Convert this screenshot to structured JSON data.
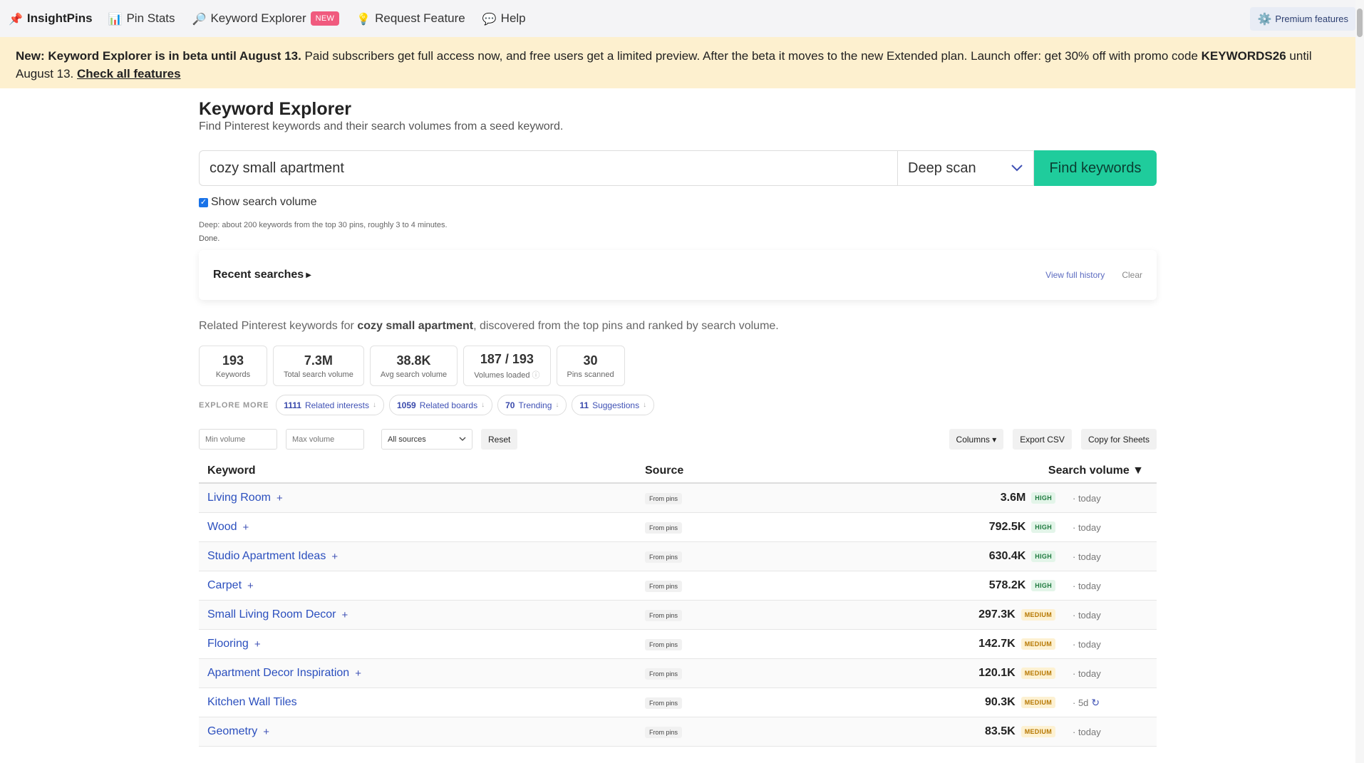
{
  "nav": {
    "brand": "InsightPins",
    "items": [
      {
        "label": "Pin Stats",
        "icon": "📊"
      },
      {
        "label": "Keyword Explorer",
        "icon": "🔎",
        "badge": "NEW"
      },
      {
        "label": "Request Feature",
        "icon": "💡"
      },
      {
        "label": "Help",
        "icon": "💬"
      }
    ],
    "brand_icon": "📌",
    "premium_label": "Premium features",
    "premium_icon": "⚙️"
  },
  "banner": {
    "lead": "New: Keyword Explorer is in beta until August 13.",
    "body": " Paid subscribers get full access now, and free users get a limited preview. After the beta it moves to the new Extended plan. Launch offer: get 30% off with promo code ",
    "promo": "KEYWORDS26",
    "tail": " until August 13. ",
    "link": "Check all features"
  },
  "page": {
    "title": "Keyword Explorer",
    "subtitle": "Find Pinterest keywords and their search volumes from a seed keyword."
  },
  "search": {
    "value": "cozy small apartment",
    "scan_mode": "Deep scan",
    "button": "Find keywords",
    "show_volume_label": "Show search volume",
    "show_volume_checked": true,
    "hint": "Deep: about 200 keywords from the top 30 pins, roughly 3 to 4 minutes.",
    "status": "Done."
  },
  "recent": {
    "title": "Recent searches",
    "view_history": "View full history",
    "clear": "Clear"
  },
  "results_intro": {
    "prefix": "Related Pinterest keywords for ",
    "seed": "cozy small apartment",
    "suffix": ", discovered from the top pins and ranked by search volume."
  },
  "stats": [
    {
      "value": "193",
      "label": "Keywords"
    },
    {
      "value": "7.3M",
      "label": "Total search volume"
    },
    {
      "value": "38.8K",
      "label": "Avg search volume"
    },
    {
      "value": "187 / 193",
      "label": "Volumes loaded"
    },
    {
      "value": "30",
      "label": "Pins scanned"
    }
  ],
  "explore": {
    "label": "EXPLORE MORE",
    "chips": [
      {
        "count": "1111",
        "label": "Related interests"
      },
      {
        "count": "1059",
        "label": "Related boards"
      },
      {
        "count": "70",
        "label": "Trending"
      },
      {
        "count": "11",
        "label": "Suggestions"
      }
    ]
  },
  "filters": {
    "min_placeholder": "Min volume",
    "max_placeholder": "Max volume",
    "source_selected": "All sources",
    "reset": "Reset",
    "columns": "Columns ▾",
    "export": "Export CSV",
    "copy": "Copy for Sheets"
  },
  "table": {
    "headers": {
      "keyword": "Keyword",
      "source": "Source",
      "volume": "Search volume ▼"
    },
    "rows": [
      {
        "keyword": "Living Room",
        "plus": "+",
        "source": "From pins",
        "volume": "3.6M",
        "level": "HIGH",
        "age": "· today",
        "refresh": ""
      },
      {
        "keyword": "Wood",
        "plus": "+",
        "source": "From pins",
        "volume": "792.5K",
        "level": "HIGH",
        "age": "· today",
        "refresh": ""
      },
      {
        "keyword": "Studio Apartment Ideas",
        "plus": "+",
        "source": "From pins",
        "volume": "630.4K",
        "level": "HIGH",
        "age": "· today",
        "refresh": ""
      },
      {
        "keyword": "Carpet",
        "plus": "+",
        "source": "From pins",
        "volume": "578.2K",
        "level": "HIGH",
        "age": "· today",
        "refresh": ""
      },
      {
        "keyword": "Small Living Room Decor",
        "plus": "+",
        "source": "From pins",
        "volume": "297.3K",
        "level": "MEDIUM",
        "age": "· today",
        "refresh": ""
      },
      {
        "keyword": "Flooring",
        "plus": "+",
        "source": "From pins",
        "volume": "142.7K",
        "level": "MEDIUM",
        "age": "· today",
        "refresh": ""
      },
      {
        "keyword": "Apartment Decor Inspiration",
        "plus": "+",
        "source": "From pins",
        "volume": "120.1K",
        "level": "MEDIUM",
        "age": "· today",
        "refresh": ""
      },
      {
        "keyword": "Kitchen Wall Tiles",
        "plus": "",
        "source": "From pins",
        "volume": "90.3K",
        "level": "MEDIUM",
        "age": "· 5d",
        "refresh": "↻"
      },
      {
        "keyword": "Geometry",
        "plus": "+",
        "source": "From pins",
        "volume": "83.5K",
        "level": "MEDIUM",
        "age": "· today",
        "refresh": ""
      }
    ]
  }
}
